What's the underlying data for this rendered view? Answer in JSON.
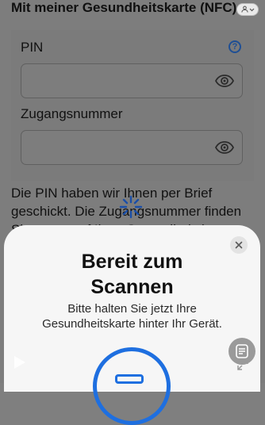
{
  "header": {
    "title": "Mit meiner Gesundheitskarte (NFC)"
  },
  "form": {
    "pin_label": "PIN",
    "pin_value": "",
    "access_label": "Zugangsnummer",
    "access_value": ""
  },
  "info_text": "Die PIN haben wir Ihnen per Brief geschickt. Die Zugangsnummer finden Sie vorne auf Ihrer Gesundheitskarte.",
  "scan_sheet": {
    "title_line1": "Bereit zum",
    "title_line2": "Scannen",
    "instruction": "Bitte halten Sie jetzt Ihre Gesundheitskarte hinter Ihr Gerät."
  },
  "colors": {
    "accent": "#1e6fe0",
    "help": "#1f4f94"
  },
  "icons": {
    "help": "question-circle-icon",
    "eye": "eye-icon",
    "close": "close-icon",
    "nfc": "nfc-scan-icon",
    "play": "play-icon",
    "reader": "reader-icon",
    "expand": "expand-icon",
    "avatar": "user-chevron-icon"
  }
}
